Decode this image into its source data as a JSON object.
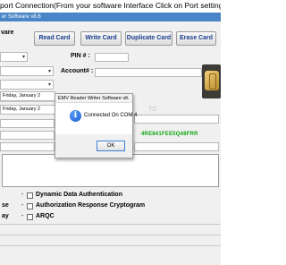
{
  "top_instruction": "port Connection(From your software Interface Click on Port setting)",
  "window": {
    "title": "er Software v8.6"
  },
  "header": {
    "field_label": "vare"
  },
  "toolbar": {
    "read_card": "Read Card",
    "write_card": "Write Card",
    "duplicate_card": "Duplicate Card",
    "erase_card": "Erase Card"
  },
  "fields": {
    "pin_label": "PIN # :",
    "account_label": "Account# :"
  },
  "dates": {
    "row1": {
      "day": "Friday",
      "sep": ",",
      "month": "January",
      "num": "2"
    },
    "row2": {
      "day": "Friday",
      "sep": ",",
      "month": "January",
      "num": "2"
    }
  },
  "watermark": "TD",
  "hex_line": "4RE841FEE5Q48FRR",
  "dialog": {
    "title": "EMV Reader Writer Software v...",
    "message": "Connected On COM 4",
    "ok_label": "OK",
    "close_glyph": "✕"
  },
  "options": [
    {
      "prefix": "",
      "dash": "-",
      "label": "Dynamic Data Authentication",
      "checked": false
    },
    {
      "prefix": "se",
      "dash": "-",
      "label": "Authorization Response Cryptogram",
      "checked": false
    },
    {
      "prefix": "ay",
      "dash": "-",
      "label": "ARQC",
      "checked": false
    }
  ]
}
